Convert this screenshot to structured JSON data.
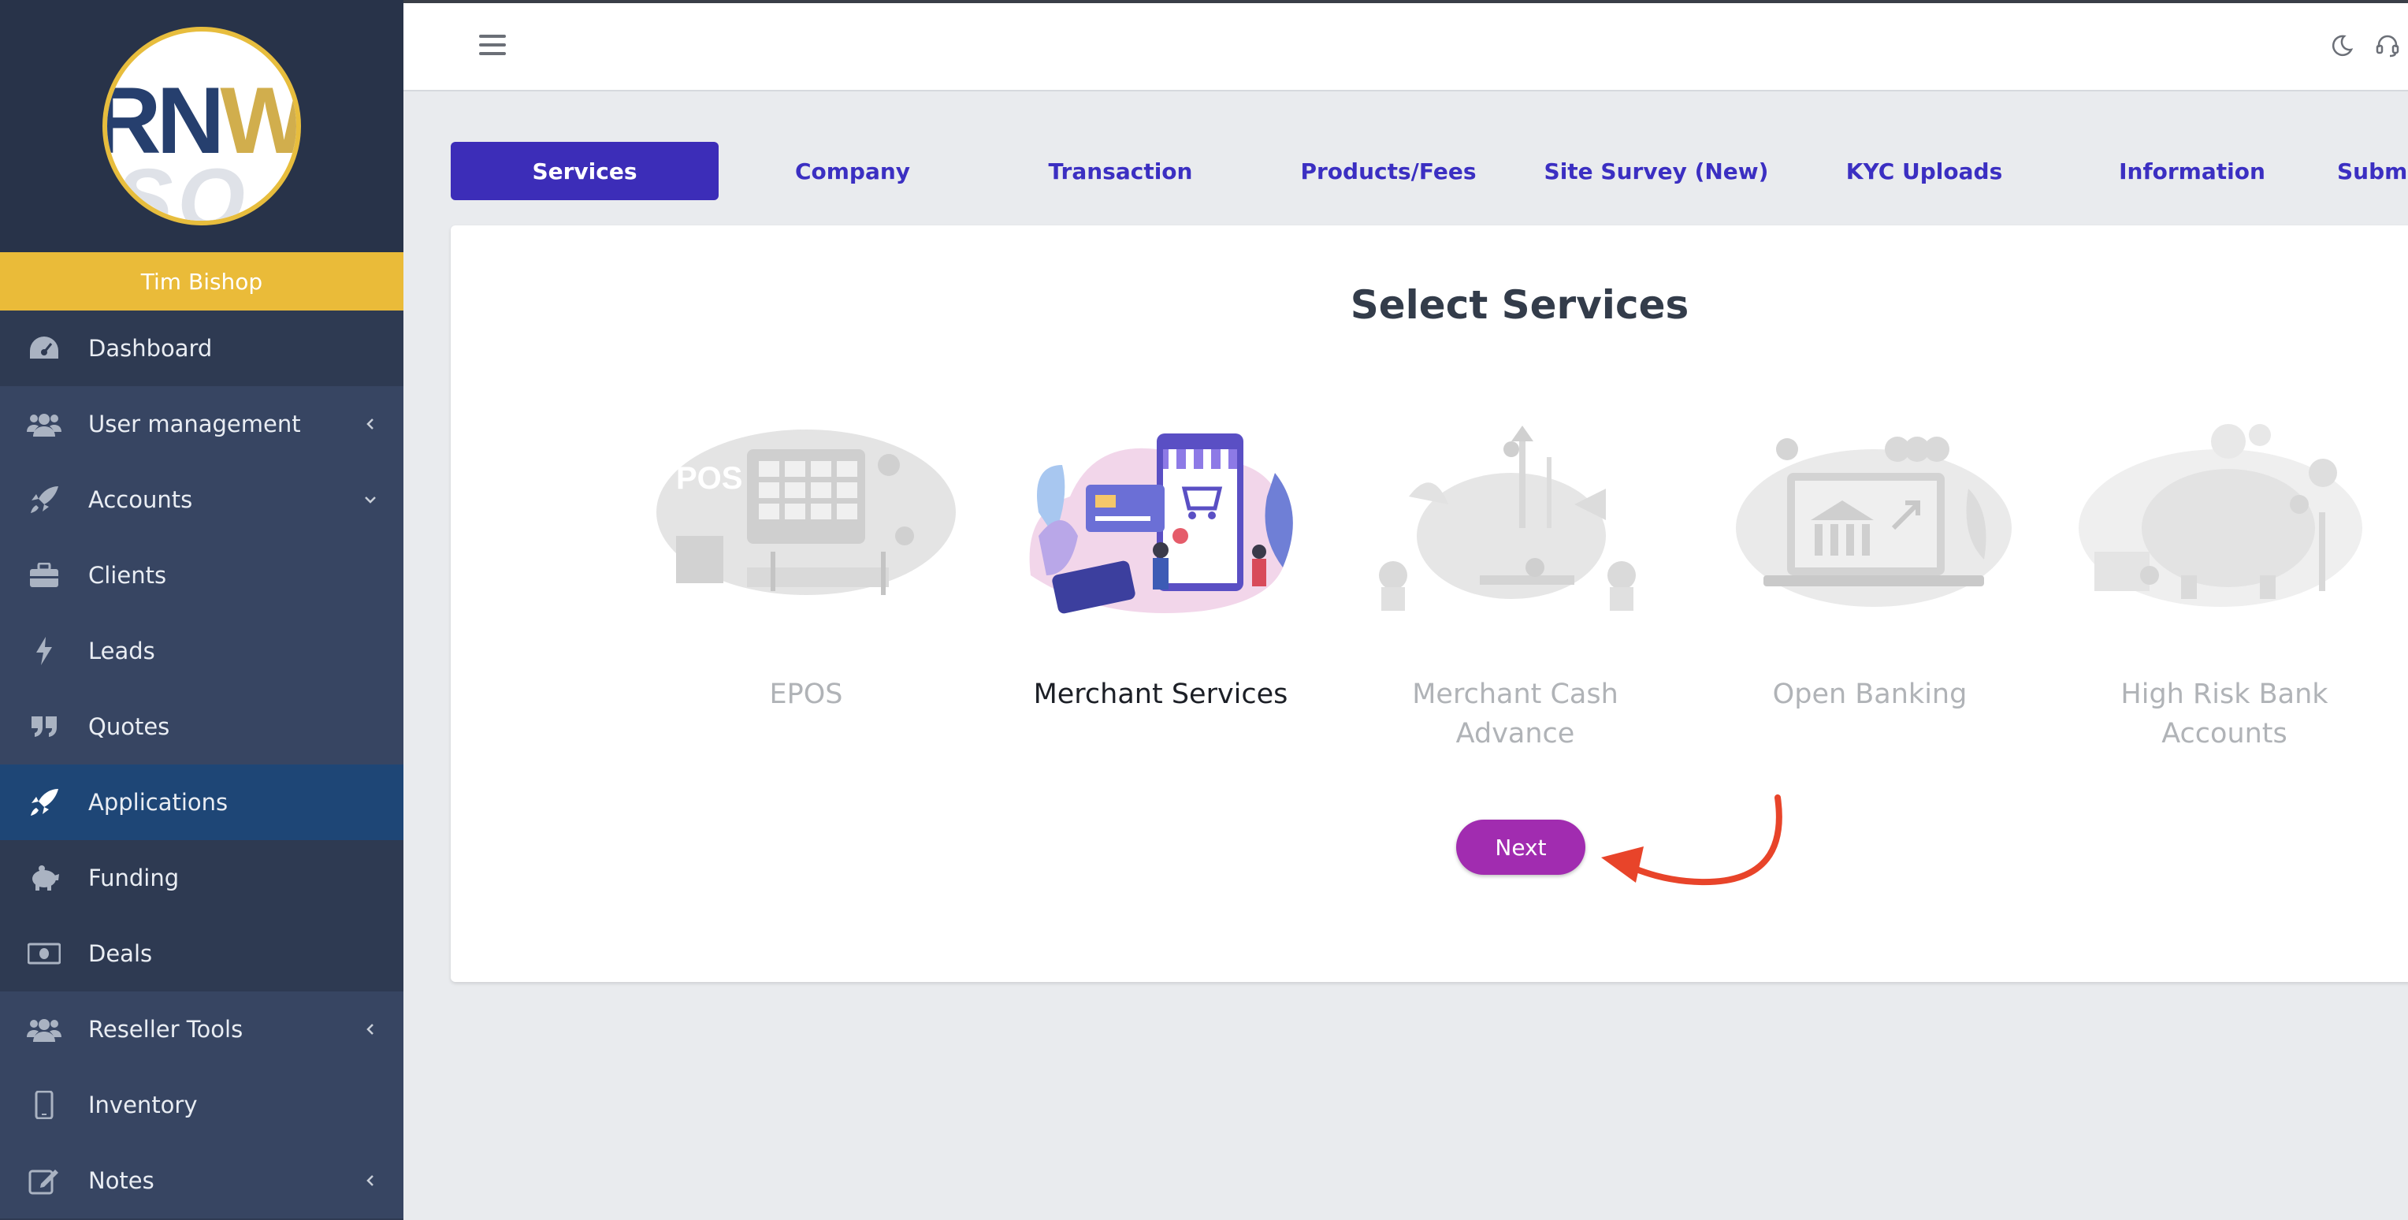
{
  "sidebar": {
    "user_name": "Tim Bishop",
    "items": [
      {
        "label": "Dashboard",
        "icon": "gauge-icon"
      },
      {
        "label": "User management",
        "icon": "users-icon",
        "chevron": "left"
      },
      {
        "label": "Accounts",
        "icon": "rocket-icon",
        "chevron": "down"
      },
      {
        "label": "Clients",
        "icon": "briefcase-icon"
      },
      {
        "label": "Leads",
        "icon": "bolt-icon"
      },
      {
        "label": "Quotes",
        "icon": "quote-icon"
      },
      {
        "label": "Applications",
        "icon": "rocket-icon",
        "active": true
      },
      {
        "label": "Funding",
        "icon": "piggy-bank-icon"
      },
      {
        "label": "Deals",
        "icon": "money-icon"
      },
      {
        "label": "Reseller Tools",
        "icon": "users-icon",
        "chevron": "left"
      },
      {
        "label": "Inventory",
        "icon": "mobile-icon"
      },
      {
        "label": "Notes",
        "icon": "edit-icon",
        "chevron": "left"
      }
    ]
  },
  "tabs": [
    {
      "label": "Services",
      "active": true
    },
    {
      "label": "Company"
    },
    {
      "label": "Transaction"
    },
    {
      "label": "Products/Fees"
    },
    {
      "label": "Site Survey (New)"
    },
    {
      "label": "KYC Uploads"
    },
    {
      "label": "Information"
    },
    {
      "label": "Subm"
    }
  ],
  "main": {
    "title": "Select Services",
    "services": [
      {
        "label": "EPOS",
        "selected": false
      },
      {
        "label": "Merchant Services",
        "selected": true
      },
      {
        "label": "Merchant Cash Advance",
        "selected": false
      },
      {
        "label": "Open Banking",
        "selected": false
      },
      {
        "label": "High Risk Bank Accounts",
        "selected": false
      }
    ],
    "next_label": "Next"
  },
  "colors": {
    "sidebar_bg": "#2e3a52",
    "user_bar": "#eabb39",
    "active_nav": "#1e4676",
    "tab_active": "#3c2db8",
    "tab_text": "#3b2fc2",
    "next_button": "#a12cb0",
    "annotation_arrow": "#e8442a"
  }
}
